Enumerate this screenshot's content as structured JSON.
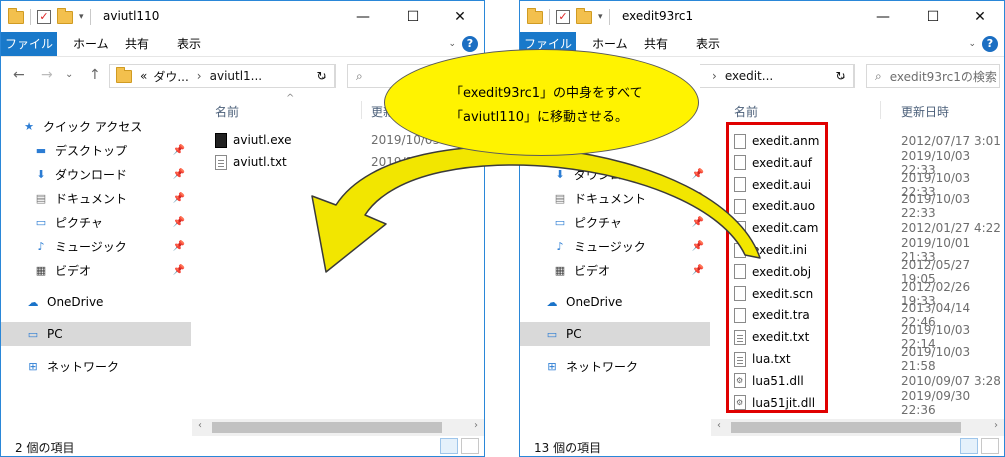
{
  "left": {
    "title": "aviutl110",
    "tabs": [
      "ファイル",
      "ホーム",
      "共有",
      "表示"
    ],
    "address": [
      "«",
      "ダウ...",
      "aviutl1..."
    ],
    "search_placeholder": "",
    "nav": [
      "クイック アクセス",
      "デスクトップ",
      "ダウンロード",
      "ドキュメント",
      "ピクチャ",
      "ミュージック",
      "ビデオ",
      "OneDrive",
      "PC",
      "ネットワーク"
    ],
    "col_name": "名前",
    "col_date": "更新",
    "files": [
      {
        "name": "aviutl.exe",
        "date": "2019/10/03 22:"
      },
      {
        "name": "aviutl.txt",
        "date": "2019/10/03 21:53"
      }
    ],
    "status": "2 個の項目"
  },
  "right": {
    "title": "exedit93rc1",
    "tabs": [
      "ファイル",
      "ホーム",
      "共有",
      "表示"
    ],
    "address": [
      "exedit..."
    ],
    "search_placeholder": "exedit93rc1の検索",
    "nav": [
      "ダウンロード",
      "ドキュメント",
      "ピクチャ",
      "ミュージック",
      "ビデオ",
      "OneDrive",
      "PC",
      "ネットワーク"
    ],
    "col_name": "名前",
    "col_date": "更新日時",
    "files": [
      {
        "name": "exedit.anm",
        "date": "2012/07/17 3:01"
      },
      {
        "name": "exedit.auf",
        "date": "2019/10/03 22:33"
      },
      {
        "name": "exedit.aui",
        "date": "2019/10/03 22:33"
      },
      {
        "name": "exedit.auo",
        "date": "2019/10/03 22:33"
      },
      {
        "name": "exedit.cam",
        "date": "2012/01/27 4:22"
      },
      {
        "name": "exedit.ini",
        "date": "2019/10/01 21:33"
      },
      {
        "name": "exedit.obj",
        "date": "2012/05/27 19:05"
      },
      {
        "name": "exedit.scn",
        "date": "2012/02/26 19:33"
      },
      {
        "name": "exedit.tra",
        "date": "2013/04/14 22:46"
      },
      {
        "name": "exedit.txt",
        "date": "2019/10/03 22:14"
      },
      {
        "name": "lua.txt",
        "date": "2019/10/03 21:58"
      },
      {
        "name": "lua51.dll",
        "date": "2010/09/07 3:28"
      },
      {
        "name": "lua51jit.dll",
        "date": "2019/09/30 22:36"
      }
    ],
    "status": "13 個の項目"
  },
  "callout": {
    "line1": "「exedit93rc1」の中身をすべて",
    "line2": "「aviutl110」に移動させる。"
  },
  "colors": {
    "accent": "#1979ca",
    "highlight": "#e00000",
    "balloon": "#fff300",
    "arrow": "#f2e600"
  }
}
